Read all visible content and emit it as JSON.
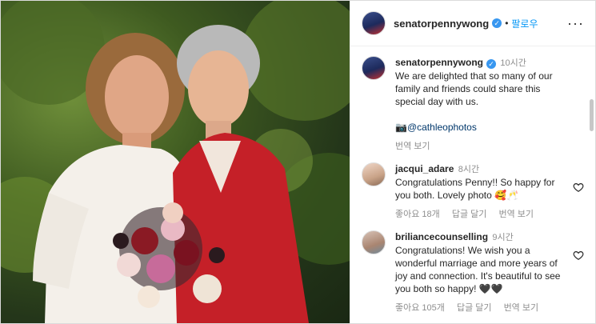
{
  "post": {
    "username": "senatorpennywong",
    "follow_label": "팔로우",
    "caption_time": "10시간",
    "caption": "We are delighted that so many of our family and friends could share this special day with us.",
    "photo_credit": "@cathleophotos",
    "translate_label": "번역 보기"
  },
  "comments": [
    {
      "username": "jacqui_adare",
      "time": "8시간",
      "text": "Congratulations Penny!! So happy for you both. Lovely photo 🥰🥂",
      "likes": "좋아요 18개",
      "reply": "답글 달기",
      "translate": "번역 보기"
    },
    {
      "username": "briliancecounselling",
      "time": "9시간",
      "text": "Congratulations! We wish you a wonderful marriage and more years of joy and connection. It's beautiful to see you both so happy! 🖤🖤",
      "likes": "좋아요 105개",
      "reply": "답글 달기",
      "translate": "번역 보기"
    }
  ],
  "icons": {
    "more": "more-options-icon",
    "verified": "verified-badge-icon",
    "camera": "camera-icon",
    "heart": "heart-icon"
  },
  "colors": {
    "link_blue": "#0095f6",
    "verified_blue": "#3897f0",
    "muted": "#8e8e8e"
  }
}
